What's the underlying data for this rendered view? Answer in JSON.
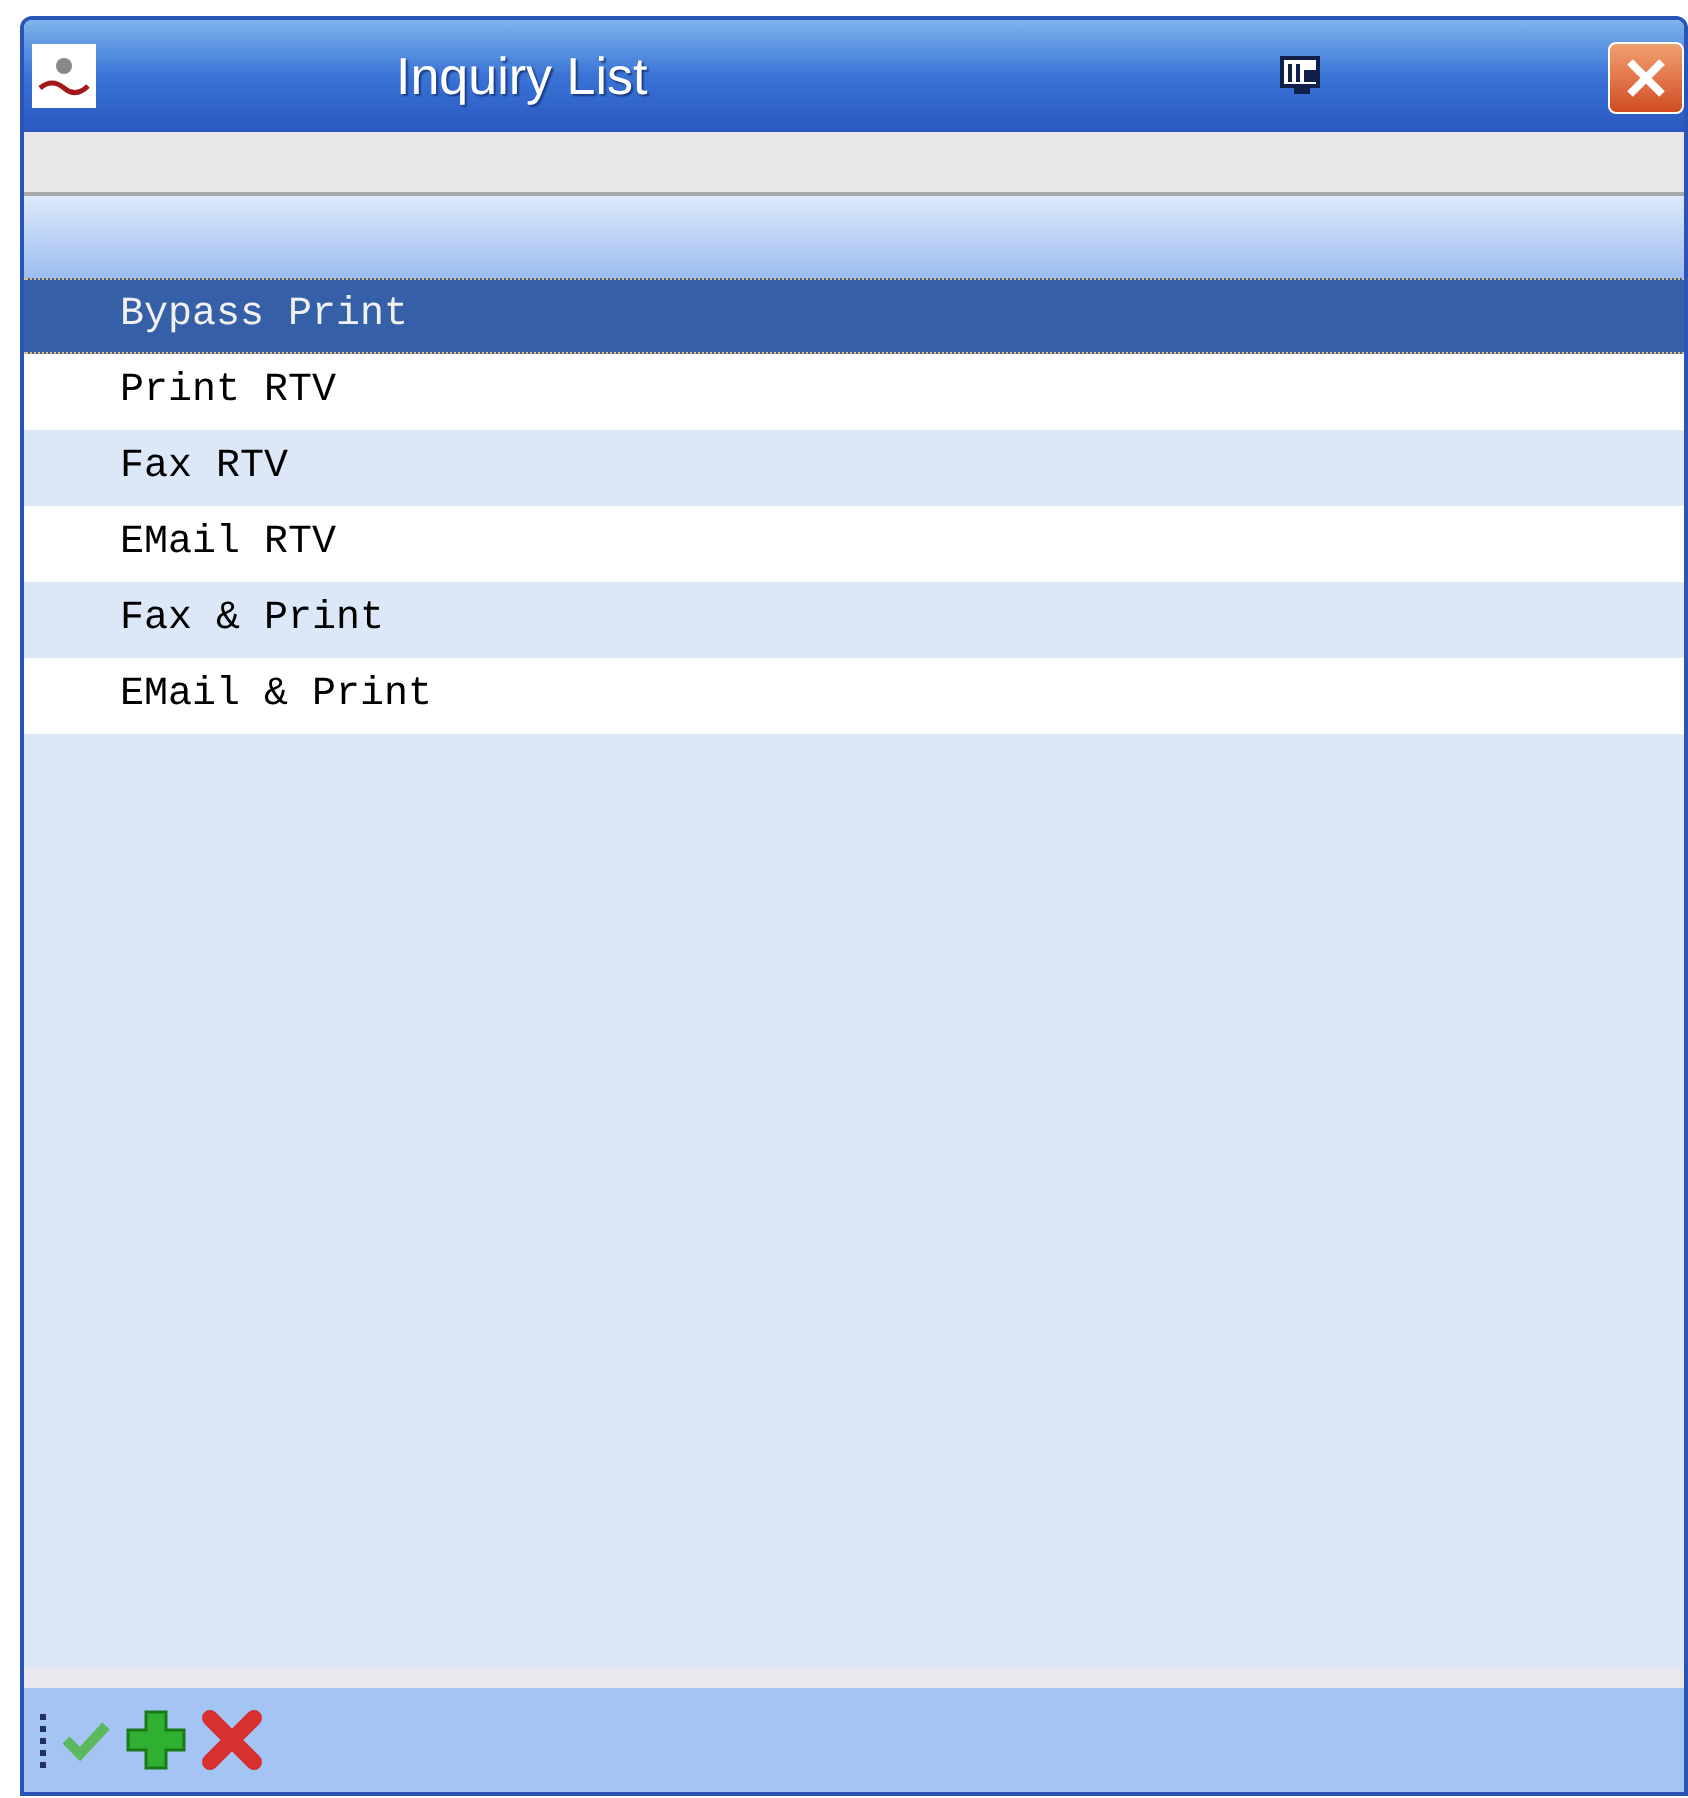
{
  "window": {
    "title": "Inquiry List"
  },
  "items": [
    {
      "label": "Bypass Print",
      "selected": true
    },
    {
      "label": "Print RTV",
      "selected": false
    },
    {
      "label": "Fax RTV",
      "selected": false
    },
    {
      "label": "EMail RTV",
      "selected": false
    },
    {
      "label": "Fax & Print",
      "selected": false
    },
    {
      "label": "EMail & Print",
      "selected": false
    }
  ]
}
